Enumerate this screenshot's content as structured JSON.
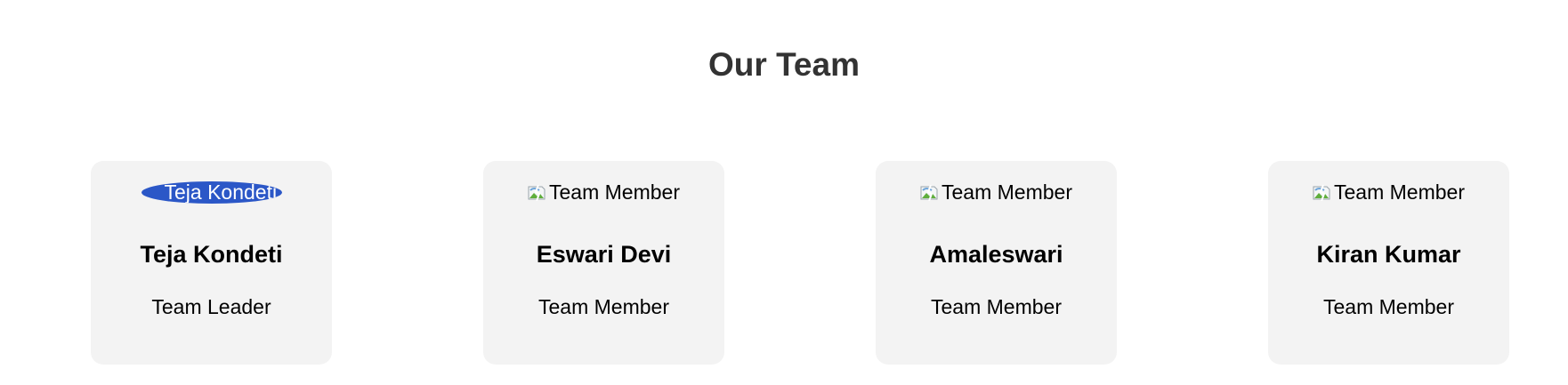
{
  "section": {
    "title": "Our Team"
  },
  "members": [
    {
      "name": "Teja Kondeti",
      "role": "Team Leader",
      "photo_alt": "Teja Kondeti",
      "photo_loaded": true
    },
    {
      "name": "Eswari Devi",
      "role": "Team Member",
      "photo_alt": "Team Member",
      "photo_loaded": false
    },
    {
      "name": "Amaleswari",
      "role": "Team Member",
      "photo_alt": "Team Member",
      "photo_loaded": false
    },
    {
      "name": "Kiran Kumar",
      "role": "Team Member",
      "photo_alt": "Team Member",
      "photo_loaded": false
    }
  ],
  "colors": {
    "card_background": "#f3f3f3",
    "title_text": "#333333",
    "leader_photo": "#2b57c7"
  },
  "icons": {
    "broken_image": "broken-image-icon"
  }
}
